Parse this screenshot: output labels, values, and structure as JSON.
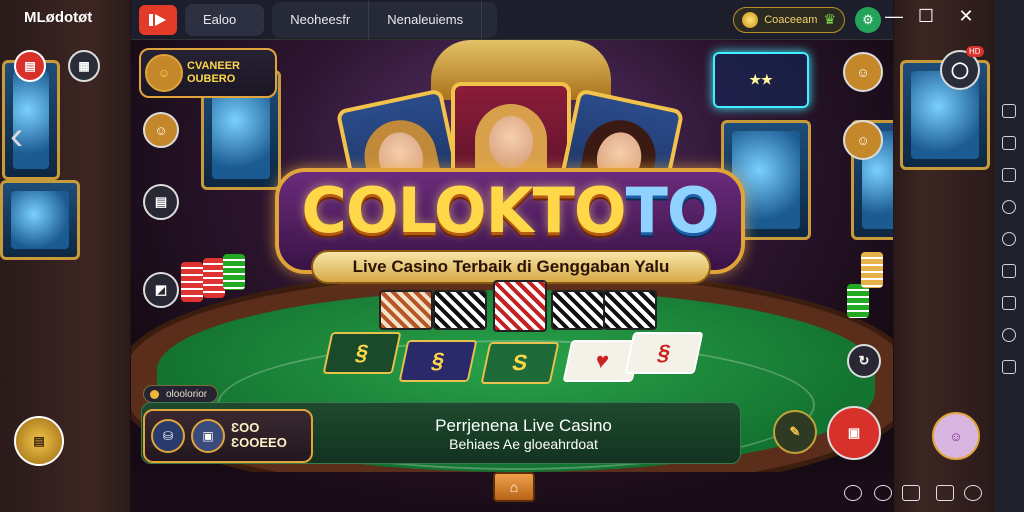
{
  "app": {
    "name": "MLødotøt"
  },
  "topbar": {
    "tabs": [
      "Ealoo",
      "Neoheesfr",
      "Nenaleuiems"
    ],
    "coins": "Coaceeam",
    "accent": "#e43a2a"
  },
  "window_controls": [
    "minimize",
    "maximize",
    "close"
  ],
  "left_buttons": {
    "red_label": "▤",
    "dark_label": "▦"
  },
  "game": {
    "logo": {
      "part1": "COLOKTO",
      "part2": "TO"
    },
    "tagline": "Live Casino Terbaik di Genggaban Yalu",
    "left_badges": [
      {
        "line1": "CVANEER",
        "line2": "OUBERO"
      }
    ],
    "small_pill": "oloolorior",
    "resource": {
      "line1": "ƐOO",
      "line2": "ƐOOEEO"
    },
    "promo": {
      "line1_prefix": "Perrjenena ",
      "line1_highlight": "Live Casino",
      "line2": "Behiaes Ae gloeahrdoat"
    },
    "hd_badge": "HD"
  },
  "colors": {
    "felt": "#1f8f3e",
    "gold": "#e0a43a",
    "neon": "#3ff0ff"
  }
}
